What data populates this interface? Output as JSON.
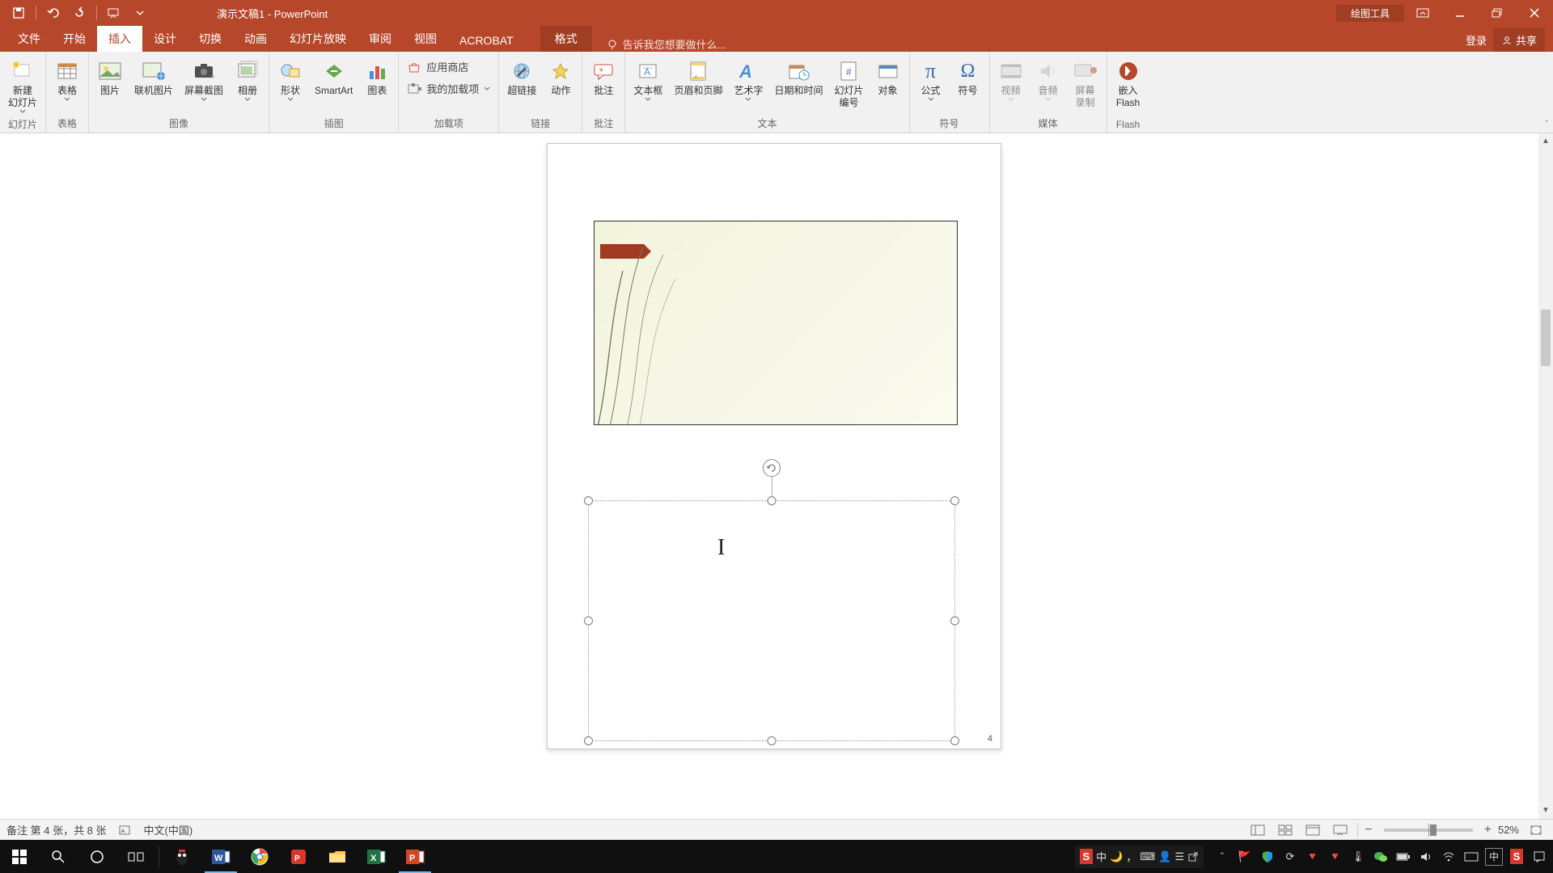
{
  "title_bar": {
    "doc_title": "演示文稿1 - PowerPoint",
    "tool_context": "绘图工具"
  },
  "tabs": {
    "file": "文件",
    "home": "开始",
    "insert": "插入",
    "design": "设计",
    "transitions": "切换",
    "animations": "动画",
    "slideshow": "幻灯片放映",
    "review": "审阅",
    "view": "视图",
    "acrobat": "ACROBAT",
    "format": "格式",
    "tell_me": "告诉我您想要做什么...",
    "login": "登录",
    "share": "共享"
  },
  "ribbon": {
    "slides": {
      "new_slide": "新建\n幻灯片",
      "table": "表格",
      "group_slides": "幻灯片",
      "group_tables": "表格"
    },
    "images": {
      "picture": "图片",
      "online_pic": "联机图片",
      "screenshot": "屏幕截图",
      "album": "相册",
      "group": "图像"
    },
    "illustrations": {
      "shapes": "形状",
      "smartart": "SmartArt",
      "chart": "图表",
      "group": "插图"
    },
    "addins": {
      "store": "应用商店",
      "myaddins": "我的加载项",
      "group": "加载项"
    },
    "links": {
      "hyperlink": "超链接",
      "action": "动作",
      "group": "链接"
    },
    "comments": {
      "comment": "批注",
      "group": "批注"
    },
    "text": {
      "textbox": "文本框",
      "header_footer": "页眉和页脚",
      "wordart": "艺术字",
      "datetime": "日期和时间",
      "slide_number": "幻灯片\n编号",
      "object": "对象",
      "group": "文本"
    },
    "symbols": {
      "equation": "公式",
      "symbol": "符号",
      "group": "符号"
    },
    "media": {
      "video": "视频",
      "audio": "音频",
      "screen_rec": "屏幕\n录制",
      "group": "媒体"
    },
    "flash": {
      "embed": "嵌入\nFlash",
      "group": "Flash"
    }
  },
  "slide": {
    "page_number": "4"
  },
  "status": {
    "notes_slide": "备注 第 4 张，共 8 张",
    "language": "中文(中国)",
    "zoom": "52%"
  },
  "ime": {
    "s": "S",
    "zh": "中"
  },
  "colors": {
    "accent": "#b7472a"
  }
}
